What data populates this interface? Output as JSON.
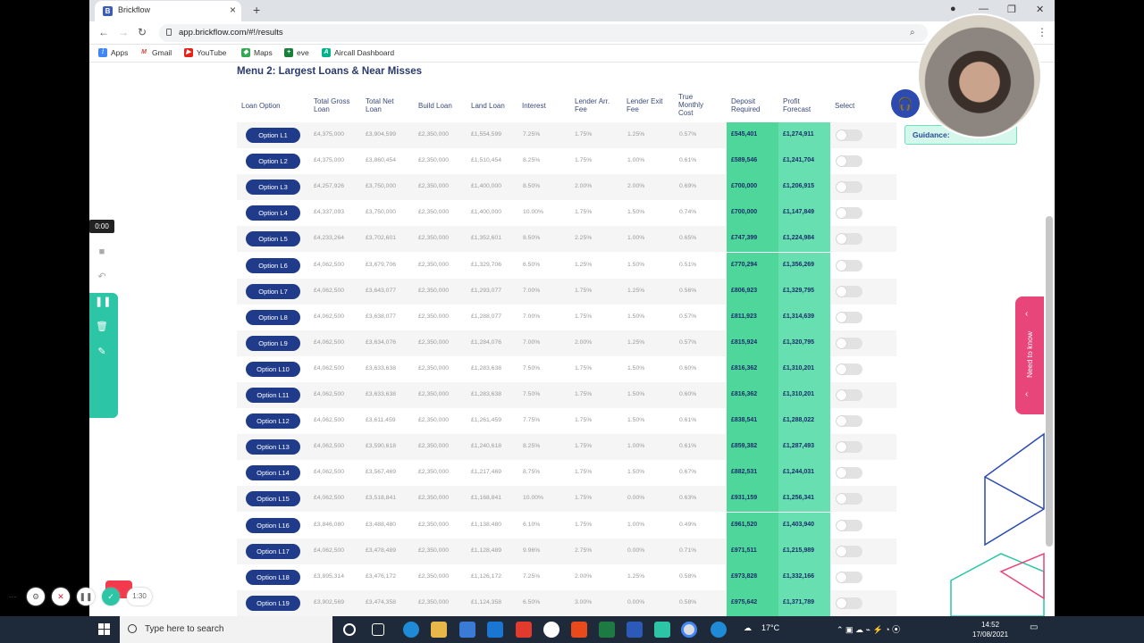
{
  "browser": {
    "tab_title": "Brickflow",
    "url": "app.brickflow.com/#!/results",
    "bookmarks": [
      "Apps",
      "Gmail",
      "YouTube",
      "Maps",
      "eve",
      "Aircall Dashboard"
    ]
  },
  "page": {
    "title": "Menu 2: Largest Loans & Near Misses",
    "headers": [
      "Loan Option",
      "Total Gross Loan",
      "Total Net Loan",
      "Build Loan",
      "Land Loan",
      "Interest",
      "Lender Arr. Fee",
      "Lender Exit Fee",
      "True Monthly Cost",
      "Deposit Required",
      "Profit Forecast",
      "Select"
    ],
    "rows": [
      {
        "option": "Option L1",
        "gross": "£4,375,000",
        "net": "£3,904,599",
        "build": "£2,350,000",
        "land": "£1,554,599",
        "interest": "7.25%",
        "arr": "1.75%",
        "exit": "1.25%",
        "tmc": "0.57%",
        "deposit": "£545,401",
        "profit": "£1,274,911"
      },
      {
        "option": "Option L2",
        "gross": "£4,375,000",
        "net": "£3,860,454",
        "build": "£2,350,000",
        "land": "£1,510,454",
        "interest": "8.25%",
        "arr": "1.75%",
        "exit": "1.00%",
        "tmc": "0.61%",
        "deposit": "£589,546",
        "profit": "£1,241,704"
      },
      {
        "option": "Option L3",
        "gross": "£4,257,926",
        "net": "£3,750,000",
        "build": "£2,350,000",
        "land": "£1,400,000",
        "interest": "8.50%",
        "arr": "2.00%",
        "exit": "2.00%",
        "tmc": "0.69%",
        "deposit": "£700,000",
        "profit": "£1,206,915"
      },
      {
        "option": "Option L4",
        "gross": "£4,337,093",
        "net": "£3,750,000",
        "build": "£2,350,000",
        "land": "£1,400,000",
        "interest": "10.00%",
        "arr": "1.75%",
        "exit": "1.50%",
        "tmc": "0.74%",
        "deposit": "£700,000",
        "profit": "£1,147,849"
      },
      {
        "option": "Option L5",
        "gross": "£4,233,264",
        "net": "£3,702,601",
        "build": "£2,350,000",
        "land": "£1,352,601",
        "interest": "8.50%",
        "arr": "2.25%",
        "exit": "1.00%",
        "tmc": "0.65%",
        "deposit": "£747,399",
        "profit": "£1,224,984"
      },
      {
        "option": "Option L6",
        "gross": "£4,062,500",
        "net": "£3,679,706",
        "build": "£2,350,000",
        "land": "£1,329,706",
        "interest": "6.50%",
        "arr": "1.25%",
        "exit": "1.50%",
        "tmc": "0.51%",
        "deposit": "£770,294",
        "profit": "£1,356,269"
      },
      {
        "option": "Option L7",
        "gross": "£4,062,500",
        "net": "£3,643,077",
        "build": "£2,350,000",
        "land": "£1,293,077",
        "interest": "7.00%",
        "arr": "1.75%",
        "exit": "1.25%",
        "tmc": "0.56%",
        "deposit": "£806,923",
        "profit": "£1,329,795"
      },
      {
        "option": "Option L8",
        "gross": "£4,062,500",
        "net": "£3,638,077",
        "build": "£2,350,000",
        "land": "£1,288,077",
        "interest": "7.00%",
        "arr": "1.75%",
        "exit": "1.50%",
        "tmc": "0.57%",
        "deposit": "£811,923",
        "profit": "£1,314,639"
      },
      {
        "option": "Option L9",
        "gross": "£4,062,500",
        "net": "£3,634,076",
        "build": "£2,350,000",
        "land": "£1,284,076",
        "interest": "7.00%",
        "arr": "2.00%",
        "exit": "1.25%",
        "tmc": "0.57%",
        "deposit": "£815,924",
        "profit": "£1,320,795"
      },
      {
        "option": "Option L10",
        "gross": "£4,062,500",
        "net": "£3,633,638",
        "build": "£2,350,000",
        "land": "£1,283,638",
        "interest": "7.50%",
        "arr": "1.75%",
        "exit": "1.50%",
        "tmc": "0.60%",
        "deposit": "£816,362",
        "profit": "£1,310,201"
      },
      {
        "option": "Option L11",
        "gross": "£4,062,500",
        "net": "£3,633,638",
        "build": "£2,350,000",
        "land": "£1,283,638",
        "interest": "7.50%",
        "arr": "1.75%",
        "exit": "1.50%",
        "tmc": "0.60%",
        "deposit": "£816,362",
        "profit": "£1,310,201"
      },
      {
        "option": "Option L12",
        "gross": "£4,062,500",
        "net": "£3,611,459",
        "build": "£2,350,000",
        "land": "£1,261,459",
        "interest": "7.75%",
        "arr": "1.75%",
        "exit": "1.50%",
        "tmc": "0.61%",
        "deposit": "£838,541",
        "profit": "£1,288,022"
      },
      {
        "option": "Option L13",
        "gross": "£4,062,500",
        "net": "£3,590,618",
        "build": "£2,350,000",
        "land": "£1,240,618",
        "interest": "8.25%",
        "arr": "1.75%",
        "exit": "1.00%",
        "tmc": "0.61%",
        "deposit": "£859,382",
        "profit": "£1,287,493"
      },
      {
        "option": "Option L14",
        "gross": "£4,062,500",
        "net": "£3,567,469",
        "build": "£2,350,000",
        "land": "£1,217,469",
        "interest": "8.75%",
        "arr": "1.75%",
        "exit": "1.50%",
        "tmc": "0.67%",
        "deposit": "£882,531",
        "profit": "£1,244,031"
      },
      {
        "option": "Option L15",
        "gross": "£4,062,500",
        "net": "£3,518,841",
        "build": "£2,350,000",
        "land": "£1,168,841",
        "interest": "10.00%",
        "arr": "1.75%",
        "exit": "0.00%",
        "tmc": "0.63%",
        "deposit": "£931,159",
        "profit": "£1,256,341"
      },
      {
        "option": "Option L16",
        "gross": "£3,846,080",
        "net": "£3,488,480",
        "build": "£2,350,000",
        "land": "£1,138,480",
        "interest": "6.10%",
        "arr": "1.75%",
        "exit": "1.00%",
        "tmc": "0.49%",
        "deposit": "£961,520",
        "profit": "£1,403,940"
      },
      {
        "option": "Option L17",
        "gross": "£4,062,500",
        "net": "£3,478,489",
        "build": "£2,350,000",
        "land": "£1,128,489",
        "interest": "9.96%",
        "arr": "2.75%",
        "exit": "0.00%",
        "tmc": "0.71%",
        "deposit": "£971,511",
        "profit": "£1,215,989"
      },
      {
        "option": "Option L18",
        "gross": "£3,895,314",
        "net": "£3,476,172",
        "build": "£2,350,000",
        "land": "£1,126,172",
        "interest": "7.25%",
        "arr": "2.00%",
        "exit": "1.25%",
        "tmc": "0.58%",
        "deposit": "£973,828",
        "profit": "£1,332,166"
      },
      {
        "option": "Option L19",
        "gross": "£3,902,569",
        "net": "£3,474,358",
        "build": "£2,350,000",
        "land": "£1,124,358",
        "interest": "6.50%",
        "arr": "3.00%",
        "exit": "0.00%",
        "tmc": "0.58%",
        "deposit": "£975,642",
        "profit": "£1,371,789"
      }
    ],
    "guidance_label": "Guidance:",
    "need_to_know": "Need to know"
  },
  "recorder": {
    "timer": "0:00",
    "elapsed": "1:30"
  },
  "taskbar": {
    "search_placeholder": "Type here to search",
    "weather": "17°C",
    "time": "14:52",
    "date": "17/08/2021"
  },
  "colors": {
    "navy": "#1f3b8a",
    "deposit_bg": "#4fd69a",
    "profit_bg": "#67dfb0",
    "accent_pink": "#e8457a",
    "teal": "#2cc5a6"
  }
}
